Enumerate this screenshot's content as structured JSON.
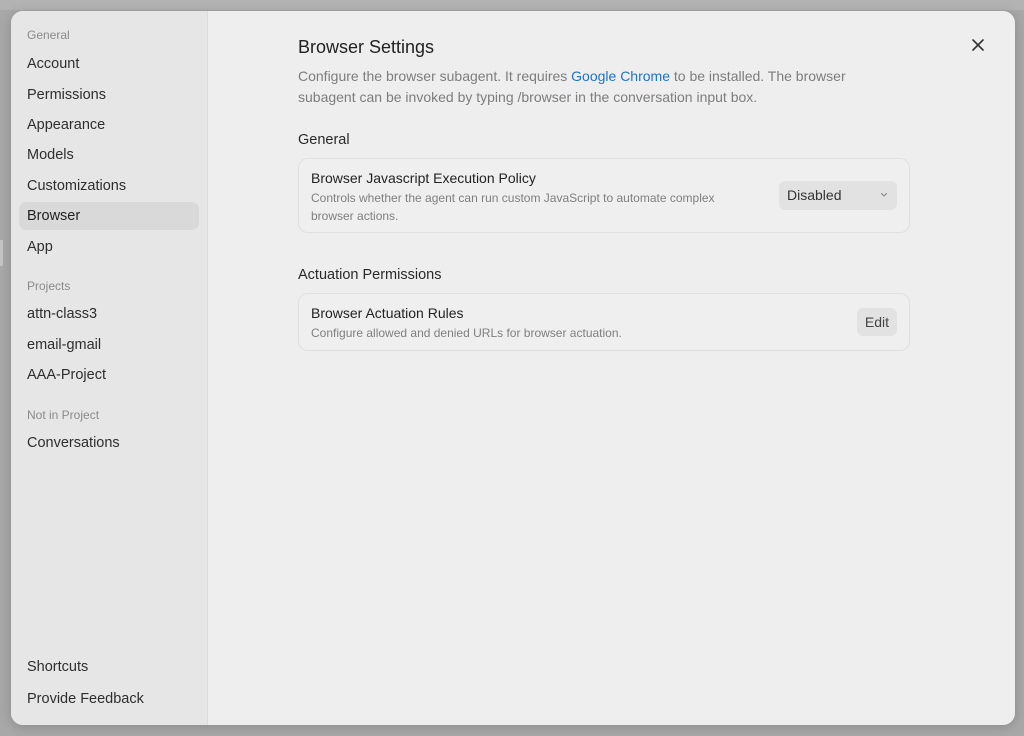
{
  "sidebar": {
    "sections": [
      {
        "label": "General"
      },
      {
        "label": "Projects"
      },
      {
        "label": "Not in Project"
      }
    ],
    "general_items": [
      {
        "label": "Account"
      },
      {
        "label": "Permissions"
      },
      {
        "label": "Appearance"
      },
      {
        "label": "Models"
      },
      {
        "label": "Customizations"
      },
      {
        "label": "Browser",
        "active": true
      },
      {
        "label": "App"
      }
    ],
    "project_items": [
      {
        "label": "attn-class3"
      },
      {
        "label": "email-gmail"
      },
      {
        "label": "AAA-Project"
      }
    ],
    "other_items": [
      {
        "label": "Conversations"
      }
    ],
    "footer_items": [
      {
        "label": "Shortcuts"
      },
      {
        "label": "Provide Feedback"
      }
    ]
  },
  "main": {
    "title": "Browser Settings",
    "description_before": "Configure the browser subagent. It requires ",
    "description_link": "Google Chrome",
    "description_after": " to be installed. The browser subagent can be invoked by typing /browser in the conversation input box.",
    "sections": [
      {
        "heading": "General",
        "setting": {
          "title": "Browser Javascript Execution Policy",
          "description": "Controls whether the agent can run custom JavaScript to automate complex browser actions.",
          "control_value": "Disabled"
        }
      },
      {
        "heading": "Actuation Permissions",
        "setting": {
          "title": "Browser Actuation Rules",
          "description": "Configure allowed and denied URLs for browser actuation.",
          "button_label": "Edit"
        }
      }
    ]
  },
  "icons": {
    "close": "close-icon",
    "chevron": "chevron-down-icon"
  },
  "colors": {
    "link": "#1f73c7",
    "active_nav": "#d9d9d9"
  }
}
